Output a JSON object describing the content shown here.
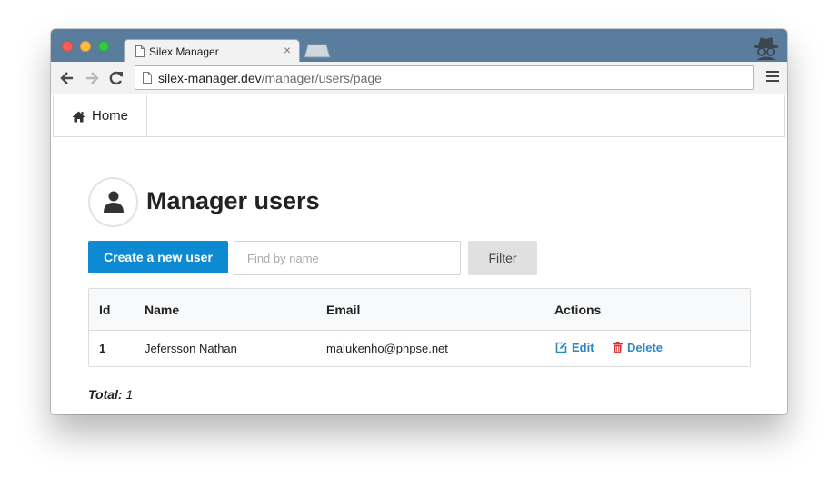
{
  "browser": {
    "tab_title": "Silex Manager",
    "tab_close": "×",
    "url_host": "silex-manager.dev",
    "url_path": "/manager/users/page"
  },
  "nav": {
    "home_label": "Home"
  },
  "page": {
    "title": "Manager users",
    "create_button": "Create a new user",
    "search_placeholder": "Find by name",
    "search_value": "",
    "filter_button": "Filter"
  },
  "table": {
    "columns": [
      "Id",
      "Name",
      "Email",
      "Actions"
    ],
    "rows": [
      {
        "id": "1",
        "name": "Jefersson Nathan",
        "email": "malukenho@phpse.net",
        "edit_label": "Edit",
        "delete_label": "Delete"
      }
    ]
  },
  "footer": {
    "total_label": "Total:",
    "total_value": "1"
  },
  "colors": {
    "primary": "#0e8ad3",
    "link": "#2b87c8",
    "delete_icon": "#d9322c",
    "titlebar": "#5b7d9d"
  },
  "icons": {
    "home": "home-icon",
    "user": "user-icon",
    "edit": "edit-icon",
    "delete": "trash-icon"
  }
}
